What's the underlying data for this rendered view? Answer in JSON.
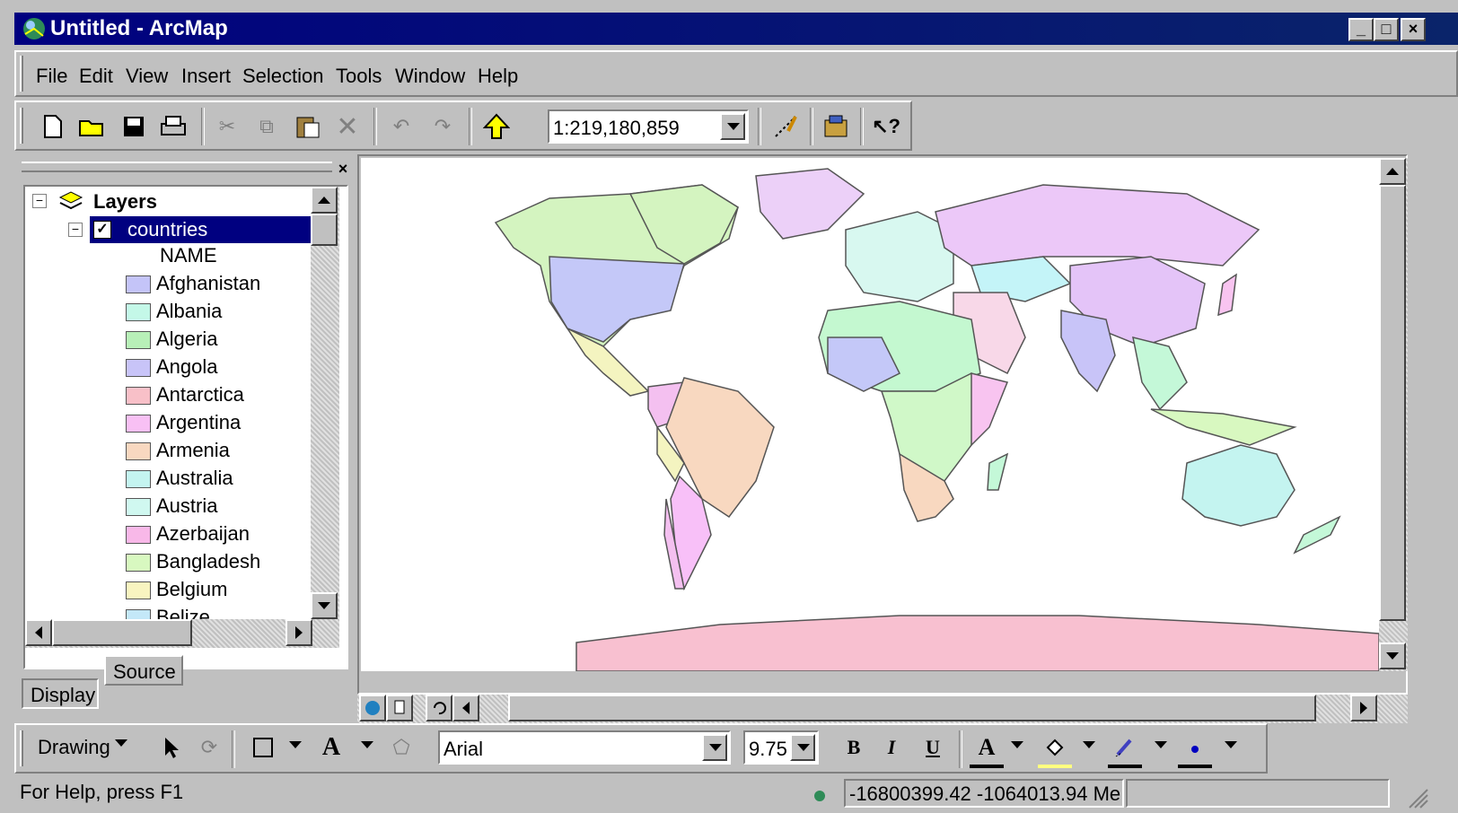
{
  "window": {
    "title": "Untitled - ArcMap",
    "controls": [
      "_",
      "□",
      "×"
    ]
  },
  "menu": {
    "items": [
      {
        "label": "File"
      },
      {
        "label": "Edit"
      },
      {
        "label": "View"
      },
      {
        "label": "Insert"
      },
      {
        "label": "Selection"
      },
      {
        "label": "Tools"
      },
      {
        "label": "Window"
      },
      {
        "label": "Help"
      }
    ]
  },
  "toolbar": {
    "buttons": [
      "new-document",
      "open",
      "save",
      "print",
      "cut",
      "copy",
      "paste",
      "delete",
      "undo",
      "redo",
      "add-data",
      "editor-toolbar",
      "arctoolbox",
      "whats-this"
    ],
    "scale": "1:219,180,859"
  },
  "toc": {
    "root_label": "Layers",
    "layer_label": "countries",
    "field_label": "NAME",
    "countries": [
      {
        "name": "Afghanistan",
        "color": "#c4c4f8"
      },
      {
        "name": "Albania",
        "color": "#c4f8e8"
      },
      {
        "name": "Algeria",
        "color": "#b8f0b8"
      },
      {
        "name": "Angola",
        "color": "#c8c4f8"
      },
      {
        "name": "Antarctica",
        "color": "#f8c0c8"
      },
      {
        "name": "Argentina",
        "color": "#f8c0f4"
      },
      {
        "name": "Armenia",
        "color": "#f8d8c0"
      },
      {
        "name": "Australia",
        "color": "#c4f4f0"
      },
      {
        "name": "Austria",
        "color": "#d0f8f0"
      },
      {
        "name": "Azerbaijan",
        "color": "#f8b8e8"
      },
      {
        "name": "Bangladesh",
        "color": "#d8f8c0"
      },
      {
        "name": "Belgium",
        "color": "#f8f4c0"
      },
      {
        "name": "Belize",
        "color": "#c4e8f8"
      }
    ],
    "tabs": [
      "Display",
      "Source"
    ]
  },
  "drawing": {
    "label": "Drawing",
    "font": "Arial",
    "size": "9.75",
    "bold": "B",
    "italic": "I",
    "underline": "U",
    "font_color_label": "A"
  },
  "status": {
    "help": "For Help, press F1",
    "coordinates": "-16800399.42  -1064013.94 Me"
  }
}
